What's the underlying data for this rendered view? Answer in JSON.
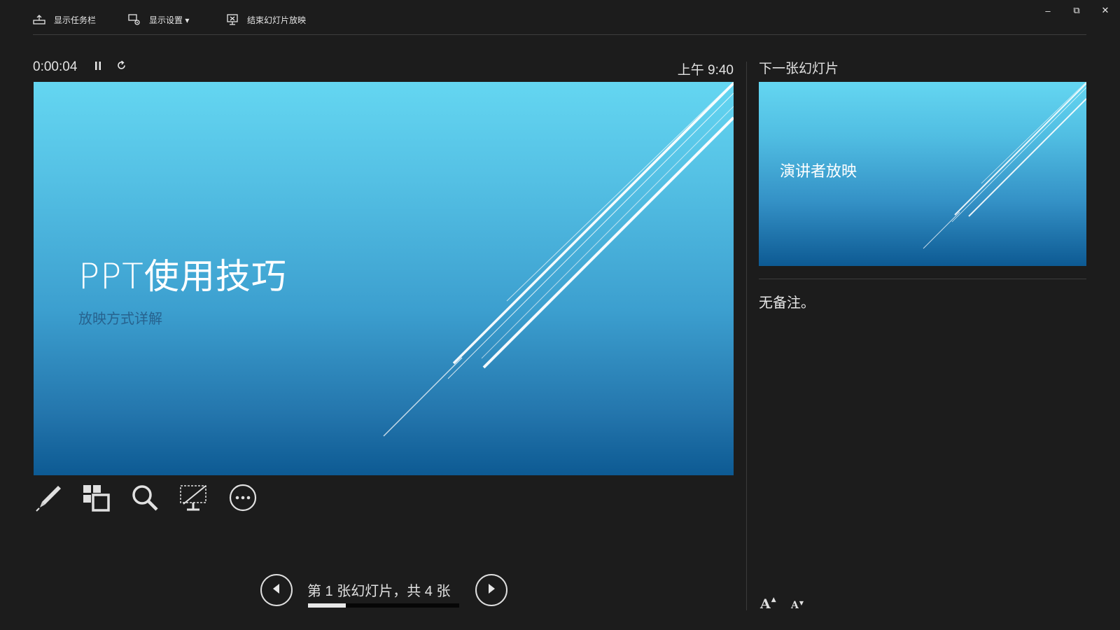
{
  "toolbar": {
    "show_taskbar": "显示任务栏",
    "display_settings": "显示设置 ▾",
    "end_slideshow": "结束幻灯片放映"
  },
  "window_controls": {
    "minimize": "–",
    "restore": "⧉",
    "close": "✕"
  },
  "timer": {
    "elapsed": "0:00:04",
    "pause_icon": "pause-icon",
    "reset_icon": "restart-icon"
  },
  "clock": "上午 9:40",
  "current_slide": {
    "title": "PPT使用技巧",
    "subtitle": "放映方式详解"
  },
  "tools": [
    "pen-icon",
    "slides-grid-icon",
    "zoom-icon",
    "black-screen-icon",
    "more-options-icon"
  ],
  "navigation": {
    "counter": "第 1 张幻灯片，共 4 张",
    "current": 1,
    "total": 4,
    "progress_fraction": 0.25
  },
  "next_slide": {
    "label": "下一张幻灯片",
    "title": "演讲者放映"
  },
  "notes": "无备注。",
  "font_controls": {
    "increase": "A",
    "decrease": "A"
  },
  "colors": {
    "background": "#1c1c1c",
    "slide_top": "#64d6f1",
    "slide_bottom": "#0d5a93",
    "subtitle": "#27628e"
  }
}
